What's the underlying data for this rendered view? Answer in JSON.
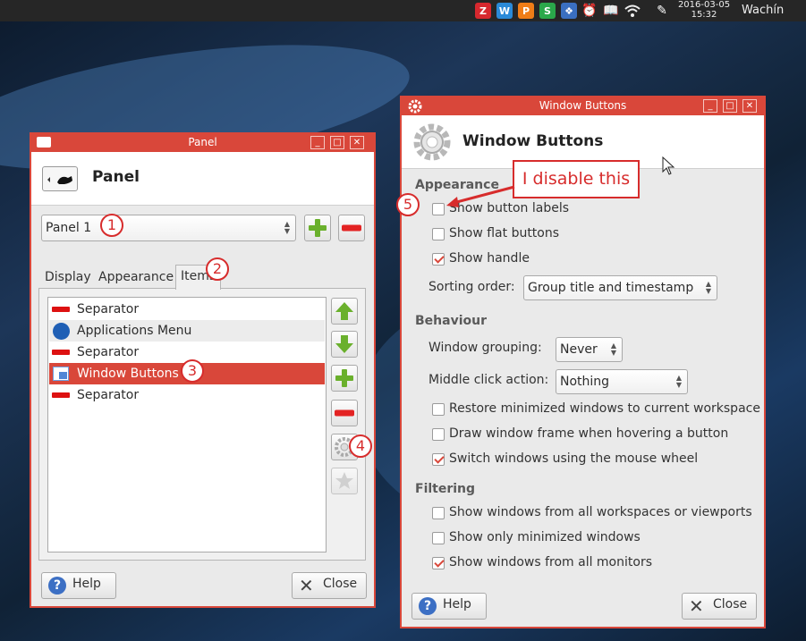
{
  "topbar": {
    "tray_icons": [
      {
        "name": "z-app-icon",
        "glyph": "Z",
        "color": "#d7282e"
      },
      {
        "name": "w-app-icon",
        "glyph": "W",
        "color": "#2a8ad8"
      },
      {
        "name": "p-app-icon",
        "glyph": "P",
        "color": "#f07d17"
      },
      {
        "name": "s-app-icon",
        "glyph": "S",
        "color": "#2aa84a"
      },
      {
        "name": "dropbox-icon",
        "glyph": "❖",
        "color": "#3a6fc0"
      }
    ],
    "date": "2016-03-05",
    "time": "15:32",
    "user": "Wachín"
  },
  "panel_window": {
    "title": "Panel",
    "header_title": "Panel",
    "panel_select": "Panel 1",
    "tabs": [
      "Display",
      "Appearance",
      "Items"
    ],
    "items": [
      {
        "label": "Separator",
        "icon": "separator-icon"
      },
      {
        "label": "Applications Menu",
        "icon": "xfce-icon"
      },
      {
        "label": "Separator",
        "icon": "separator-icon"
      },
      {
        "label": "Window Buttons",
        "icon": "window-buttons-icon"
      },
      {
        "label": "Separator",
        "icon": "separator-icon"
      }
    ],
    "help_label": "Help",
    "close_label": "Close"
  },
  "wb_window": {
    "title": "Window Buttons",
    "header_title": "Window Buttons",
    "appearance": {
      "heading": "Appearance",
      "show_button_labels": {
        "label": "Show button labels",
        "checked": false
      },
      "show_flat_buttons": {
        "label": "Show flat buttons",
        "checked": false
      },
      "show_handle": {
        "label": "Show handle",
        "checked": true
      },
      "sorting_label": "Sorting order:",
      "sorting_value": "Group title and timestamp"
    },
    "behaviour": {
      "heading": "Behaviour",
      "grouping_label": "Window grouping:",
      "grouping_value": "Never",
      "middle_label": "Middle click action:",
      "middle_value": "Nothing",
      "restore": {
        "label": "Restore minimized windows to current workspace",
        "checked": false
      },
      "draw_frame": {
        "label": "Draw window frame when hovering a button",
        "checked": false
      },
      "switch_wheel": {
        "label": "Switch windows using the mouse wheel",
        "checked": true
      }
    },
    "filtering": {
      "heading": "Filtering",
      "all_workspaces": {
        "label": "Show windows from all workspaces or viewports",
        "checked": false
      },
      "only_minimized": {
        "label": "Show only minimized windows",
        "checked": false
      },
      "all_monitors": {
        "label": "Show windows from all monitors",
        "checked": true
      }
    },
    "help_label": "Help",
    "close_label": "Close"
  },
  "annotations": {
    "n1": "1",
    "n2": "2",
    "n3": "3",
    "n4": "4",
    "n5": "5",
    "callout": "I disable this",
    "color": "#d72c2c"
  },
  "colors": {
    "accent": "#d9473a",
    "selection": "#d9473a"
  }
}
